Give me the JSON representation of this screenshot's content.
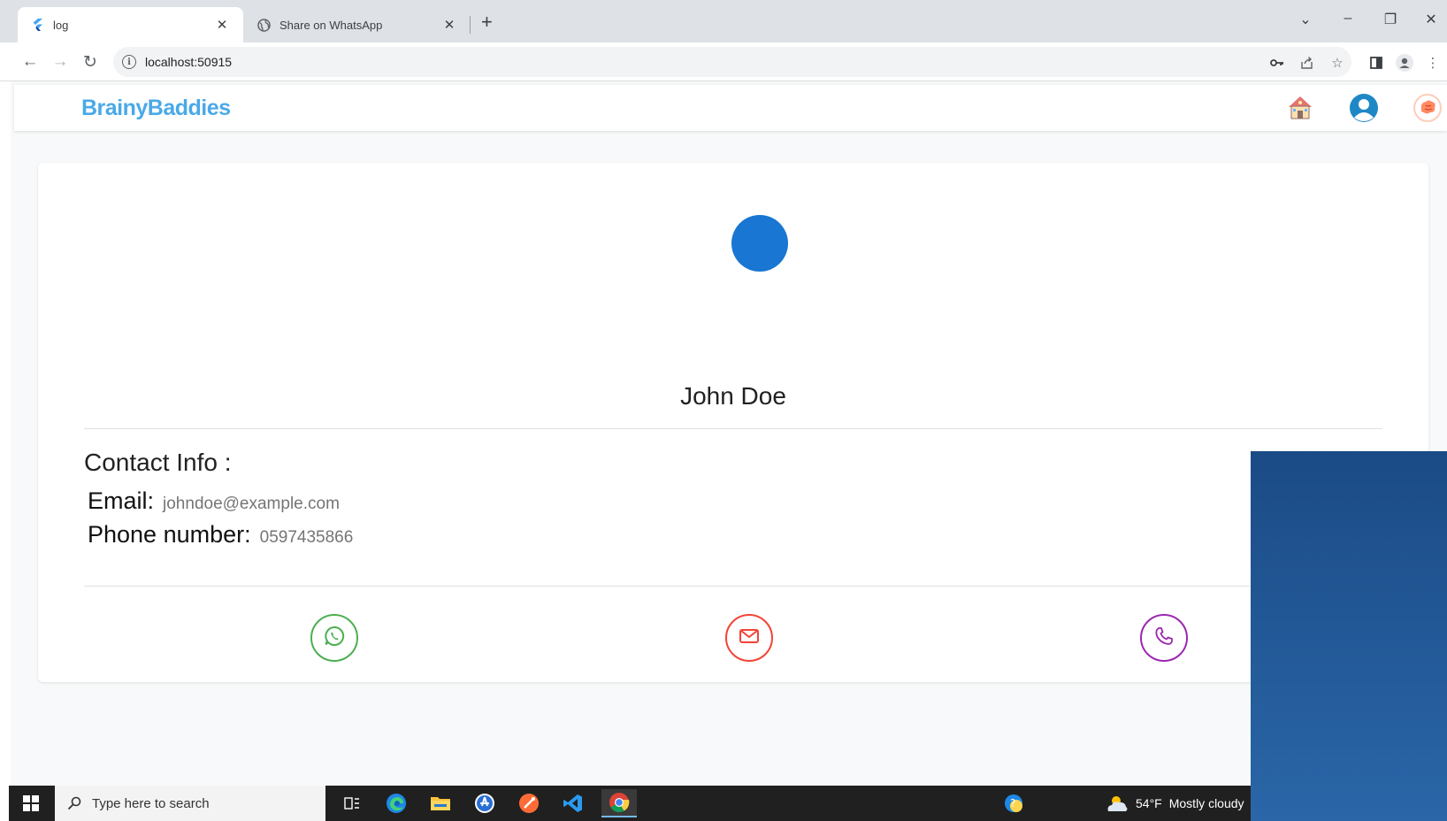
{
  "browser": {
    "tabs": [
      {
        "title": "log",
        "icon": "flutter-icon",
        "active": true
      },
      {
        "title": "Share on WhatsApp",
        "icon": "globe-icon",
        "active": false
      }
    ],
    "url": "localhost:50915"
  },
  "app": {
    "brand": "BrainyBaddies",
    "header_icons": [
      "school-house-icon",
      "user-avatar-icon",
      "brain-icon"
    ]
  },
  "profile": {
    "name": "John Doe",
    "section_title": "Contact Info :",
    "email_label": "Email:",
    "email_value": "johndoe@example.com",
    "phone_label": "Phone number:",
    "phone_value": "0597435866",
    "avatar_color": "#1976d2"
  },
  "actions": [
    {
      "name": "whatsapp-button",
      "icon": "whatsapp-icon",
      "color": "#4caf50"
    },
    {
      "name": "email-button",
      "icon": "mail-icon",
      "color": "#f44336"
    },
    {
      "name": "call-button",
      "icon": "phone-icon",
      "color": "#9c27b0"
    }
  ],
  "taskbar": {
    "search_placeholder": "Type here to search",
    "weather_temp": "54°F",
    "weather_text": "Mostly cloudy"
  }
}
